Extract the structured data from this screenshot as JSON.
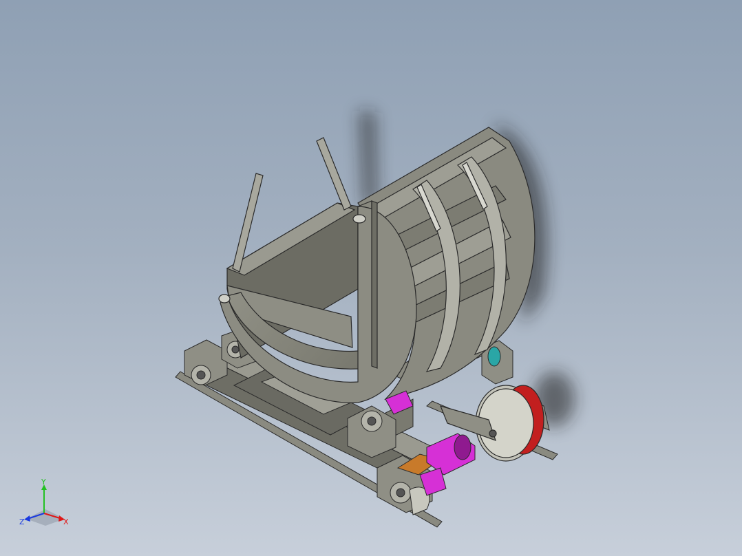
{
  "viewport": {
    "background_top": "#8fa0b4",
    "background_bottom": "#c7cfda"
  },
  "model": {
    "subject": "tilting-drum-on-rail-carriage",
    "colors": {
      "body": "#8a8a80",
      "body_light": "#a6a69c",
      "body_dark": "#5d5d55",
      "edge": "#2a2a2a",
      "motor": "#d630d6",
      "motor_dark": "#8f1a8f",
      "gearbox": "#c87a2a",
      "brake_ring": "#c21f1f",
      "bearing_teal": "#2aa6a6",
      "shadow": "#1c1c1c"
    }
  },
  "triad": {
    "y_label": "Y",
    "x_label": "X",
    "z_label": "Z",
    "y_color": "#22c122",
    "x_color": "#e01818",
    "z_color": "#1a3ae0"
  }
}
